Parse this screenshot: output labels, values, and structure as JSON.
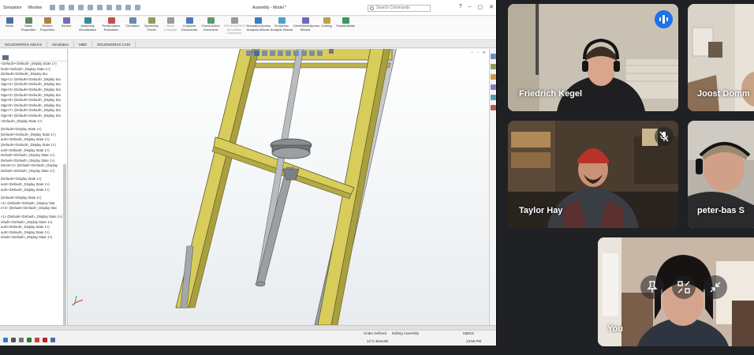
{
  "screen": {
    "app_menu": [
      "Simulation",
      "Window"
    ],
    "doc_title": "Assembly - Model *",
    "search_placeholder": "Search Commands",
    "ribbon": [
      {
        "label": "Show",
        "dim": false
      },
      {
        "label": "Mass Properties",
        "dim": false
      },
      {
        "label": "Section Properties",
        "dim": false
      },
      {
        "label": "Sensor",
        "dim": false
      },
      {
        "label": "Assembly Visualization",
        "dim": false
      },
      {
        "label": "Performance Evaluation",
        "dim": false
      },
      {
        "label": "Curvature",
        "dim": false
      },
      {
        "label": "Symmetry Check",
        "dim": false
      },
      {
        "label": "Body Compare",
        "dim": true
      },
      {
        "label": "Compare Documents",
        "dim": false
      },
      {
        "label": "Check Active Document",
        "dim": false
      },
      {
        "label": "SOLIDWORKS Simulation Connector",
        "dim": true
      },
      {
        "label": "SimulationXpress Analysis Wizard",
        "dim": false
      },
      {
        "label": "FloXpress Analysis Wizard",
        "dim": false
      },
      {
        "label": "DriveWorksXpress Wizard",
        "dim": false
      },
      {
        "label": "Costing",
        "dim": false
      },
      {
        "label": "Sustainability",
        "dim": false
      }
    ],
    "command_tabs": [
      "SOLIDWORKS Add-Ins",
      "Simulation",
      "MBD",
      "SOLIDWORKS CAM"
    ],
    "tree_rows": [
      "<Default><Default>_Display State 1>)",
      "fault><Default>_Display State 1>)",
      "(Default<<Default>_Display Sta",
      "Stge<1> (Default<<Default>_Display Sta",
      "Stge<2> (Default<<Default>_Display Sta",
      "Stge<3> (Default<<Default>_Display Sta",
      "Stge<4> (Default<<Default>_Display Sta",
      "Stge<5> (Default<<Default>_Display Sta",
      "Stge<6> (Default<<Default>_Display Sta",
      "Stge<7> (Default<<Default>_Display Sta",
      "Stge<8> (Default<<Default>_Display Sta",
      "<Default>_Display State 1>)",
      "",
      "(Default<<Display State 1>)",
      "(Default<<Default>_Display State 1>)",
      "ault<<Default>_Display State 1>)",
      "(Default<<Default>_Display State 1>)",
      "ault<<Default>_Display State 1>)",
      "Default<<Default>_Display State 1>)",
      "Default<<Default>_Display State 1>)",
      "Damm<1> (Default<<Default>_Display",
      "Default<<Default>_Display State 1>)",
      "",
      "(Default<<Display State 1>)",
      "ault<<Default>_Display State 1>)",
      "ault<<Default>_Display State 1>)",
      "",
      "(Default<<Display State 1>)",
      "<1> (Default<<Default>_Display Stat",
      "e<2> (Default<<Default>_Display Stat",
      "",
      "<1> (Default<<Default>_Display State 1>)",
      "efault<<Default>_Display State 1>)",
      "ault<<Default>_Display State 1>)",
      "ault<<Default>_Display State 1>)",
      "efault<<Default>_Display State 1>)"
    ],
    "status": {
      "fully_defined": "Under Defined",
      "editing": "Editing Assembly",
      "units": "MMGS",
      "weather_temp": "12°C",
      "weather_text": "Bewolkt",
      "time": "13:56 PM"
    }
  },
  "participants": [
    {
      "name": "Friedrich Kegel",
      "speaking": true,
      "muted": false
    },
    {
      "name": "Joost Domm",
      "speaking": false,
      "muted": false
    },
    {
      "name": "Taylor Hay",
      "speaking": false,
      "muted": true
    },
    {
      "name": "peter-bas S",
      "speaking": false,
      "muted": false
    },
    {
      "name": "You",
      "speaking": false,
      "muted": false
    }
  ],
  "self_tile_controls": [
    "pin-icon",
    "fullscreen-exit-icon",
    "minimize-icon"
  ],
  "colors": {
    "meet_bg": "#202124",
    "speaking_blue": "#1a73e8",
    "frame_yellow": "#d8cc5a",
    "frame_grey": "#a4a8ab"
  }
}
